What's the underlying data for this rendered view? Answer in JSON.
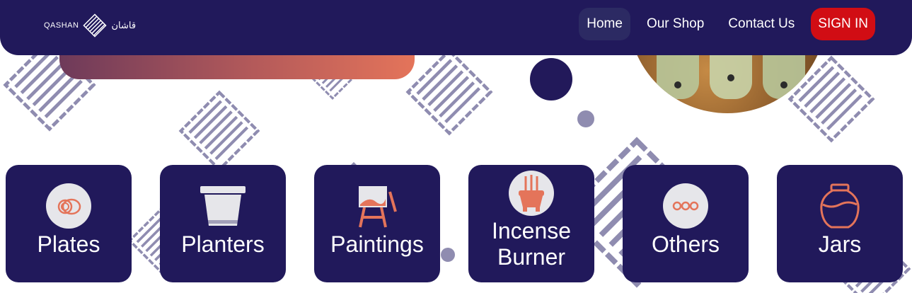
{
  "header": {
    "logo": {
      "latin": "QASHAN",
      "arabic": "قاشان"
    },
    "nav": [
      {
        "label": "Home",
        "active": true
      },
      {
        "label": "Our Shop",
        "active": false
      },
      {
        "label": "Contact Us",
        "active": false
      }
    ],
    "signin_label": "SIGN IN"
  },
  "categories": [
    {
      "label": "Plates",
      "icon": "plates-icon"
    },
    {
      "label": "Planters",
      "icon": "planter-icon"
    },
    {
      "label": "Paintings",
      "icon": "easel-icon"
    },
    {
      "label": "Incense Burner",
      "line1": "Incense",
      "line2": "Burner",
      "icon": "incense-burner-icon"
    },
    {
      "label": "Others",
      "icon": "more-icon"
    },
    {
      "label": "Jars",
      "icon": "jar-icon"
    }
  ],
  "colors": {
    "navy": "#21195b",
    "accent": "#e4745a",
    "signin": "#d10d14",
    "pattern": "#8f8cb0"
  }
}
